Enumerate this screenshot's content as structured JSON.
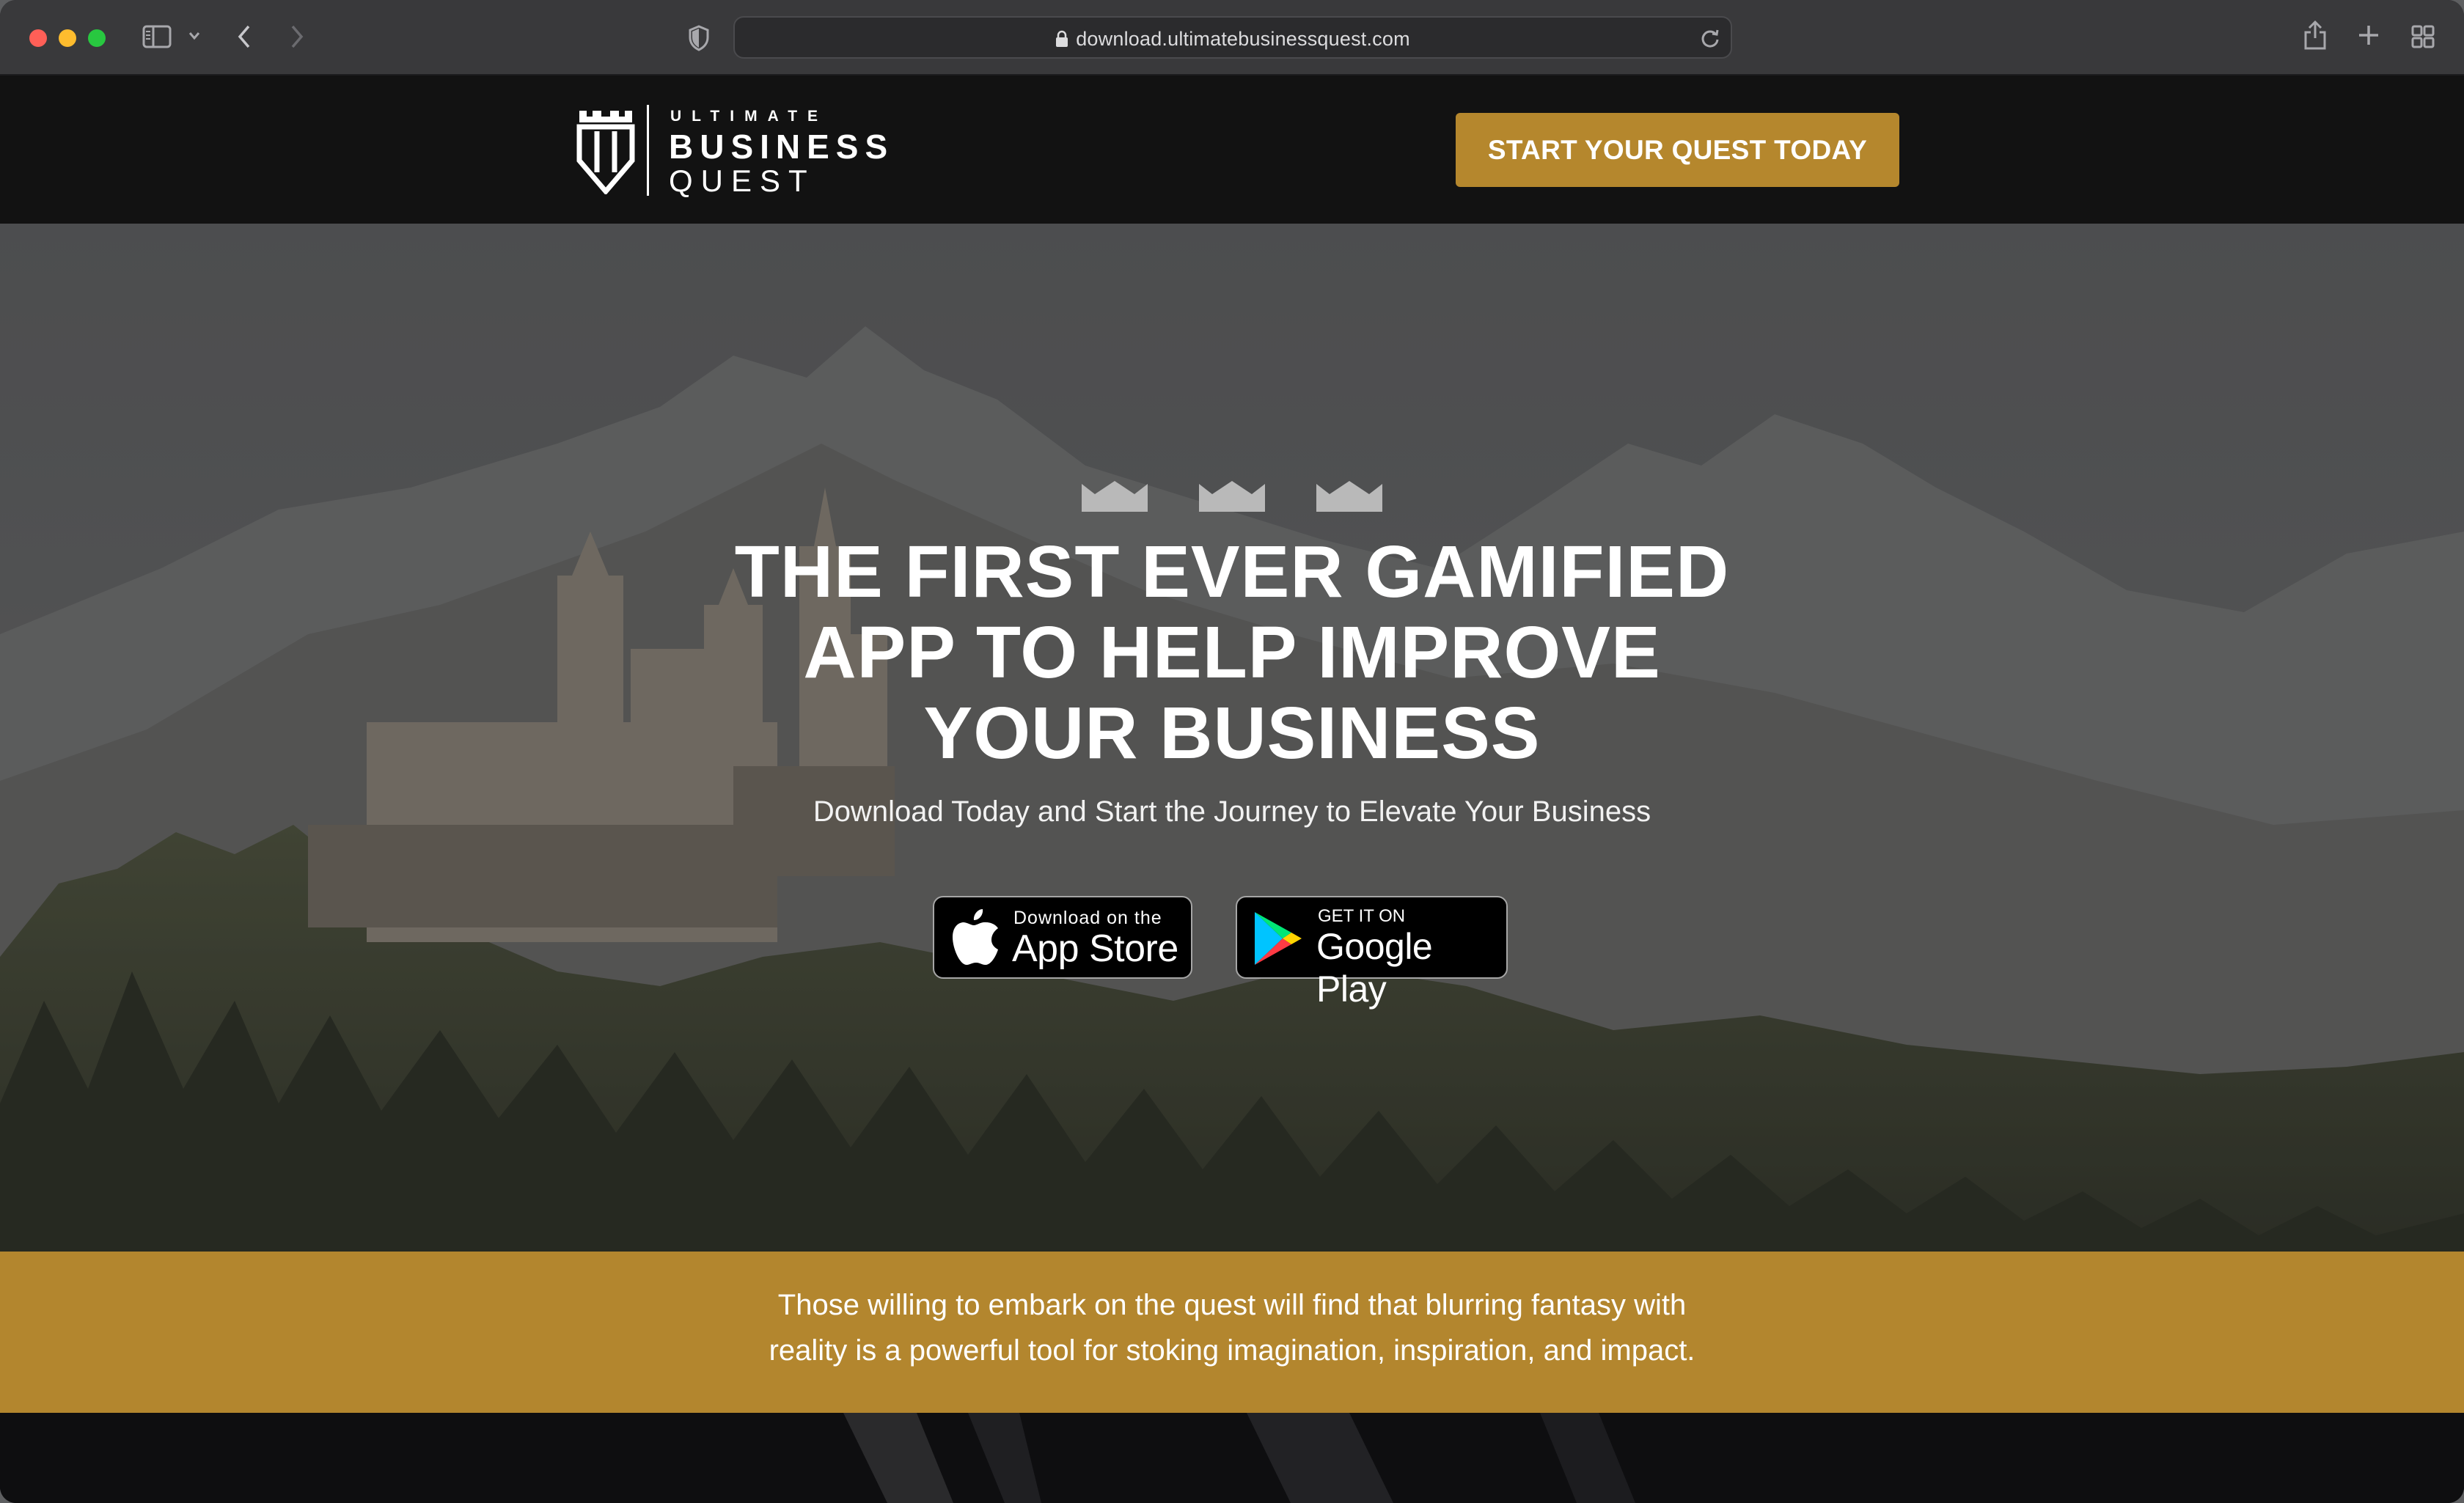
{
  "browser": {
    "url": "download.ultimatebusinessquest.com",
    "icons": [
      "sidebar-icon",
      "chevron-down-icon",
      "back-icon",
      "forward-icon",
      "shield-icon",
      "lock-icon",
      "reload-icon",
      "share-icon",
      "new-tab-icon",
      "tab-overview-icon"
    ]
  },
  "header": {
    "logo": {
      "line1": "ULTIMATE",
      "line2": "BUSINESS",
      "line3": "QUEST"
    },
    "cta_label": "START YOUR QUEST TODAY"
  },
  "hero": {
    "headline_line1": "THE FIRST EVER GAMIFIED",
    "headline_line2": "APP TO HELP IMPROVE",
    "headline_line3": "YOUR BUSINESS",
    "subheadline": "Download Today and Start the Journey to Elevate Your Business",
    "app_store": {
      "small": "Download on the",
      "big": "App Store"
    },
    "google_play": {
      "small": "GET IT ON",
      "big": "Google Play"
    }
  },
  "band": {
    "line1": "Those willing to embark on the quest will find that blurring fantasy with",
    "line2": "reality is a powerful tool for stoking imagination, inspiration, and impact."
  },
  "colors": {
    "accent_gold": "#b5872d",
    "header_bg": "#121212",
    "chrome_bg": "#39393b"
  }
}
